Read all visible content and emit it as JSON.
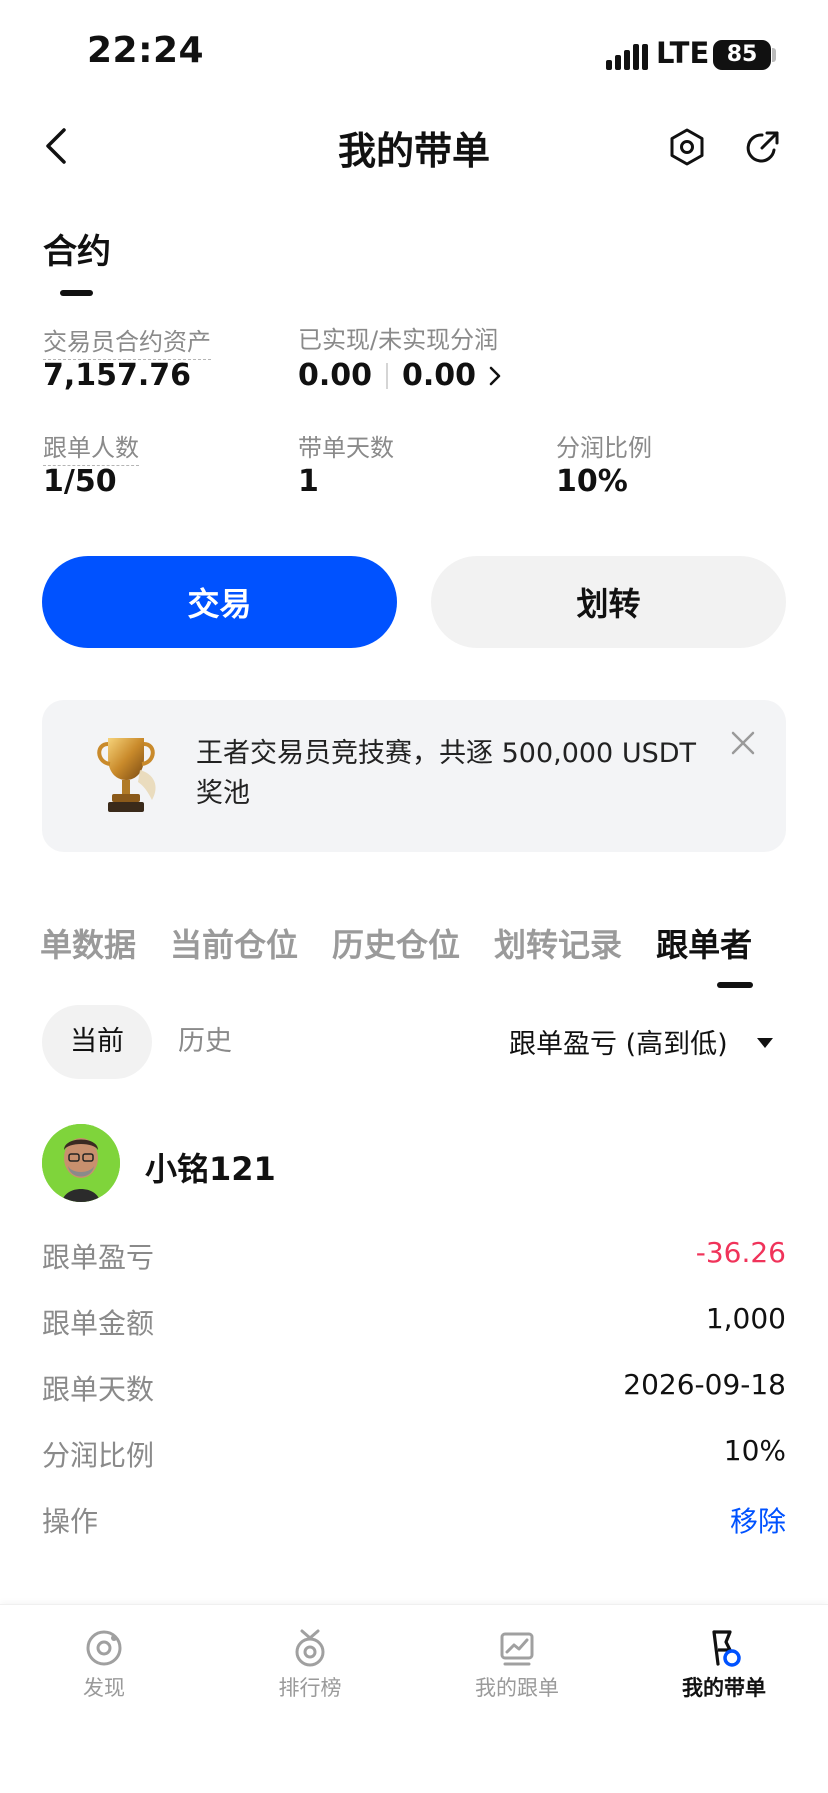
{
  "status_bar": {
    "time": "22:24",
    "network": "LTE",
    "battery": "85"
  },
  "header": {
    "title": "我的带单"
  },
  "summary": {
    "section_title": "合约",
    "trader_assets_label": "交易员合约资产",
    "trader_assets_value": "7,157.76",
    "profit_label": "已实现/未实现分润",
    "realized": "0.00",
    "unrealized": "0.00",
    "followers_label": "跟单人数",
    "followers_value": "1/50",
    "days_label": "带单天数",
    "days_value": "1",
    "share_label": "分润比例",
    "share_value": "10%"
  },
  "actions": {
    "trade": "交易",
    "transfer": "划转"
  },
  "banner": {
    "text": "王者交易员竞技赛，共逐 500,000 USDT 奖池"
  },
  "tabs": [
    "单数据",
    "当前仓位",
    "历史仓位",
    "划转记录",
    "跟单者"
  ],
  "filter": {
    "current": "当前",
    "history": "历史",
    "sort": "跟单盈亏 (高到低)"
  },
  "follower": {
    "name": "小铭121",
    "rows": [
      {
        "label": "跟单盈亏",
        "value": "-36.26"
      },
      {
        "label": "跟单金额",
        "value": "1,000"
      },
      {
        "label": "跟单天数",
        "value": "2026-09-18"
      },
      {
        "label": "分润比例",
        "value": "10%"
      },
      {
        "label": "操作",
        "value": "移除"
      }
    ]
  },
  "bottom_nav": [
    {
      "label": "发现",
      "icon": "discover-icon"
    },
    {
      "label": "排行榜",
      "icon": "medal-icon"
    },
    {
      "label": "我的跟单",
      "icon": "chart-icon"
    },
    {
      "label": "我的带单",
      "icon": "flag-icon"
    }
  ],
  "colors": {
    "accent": "#0052ff",
    "negative": "#f0335a"
  }
}
